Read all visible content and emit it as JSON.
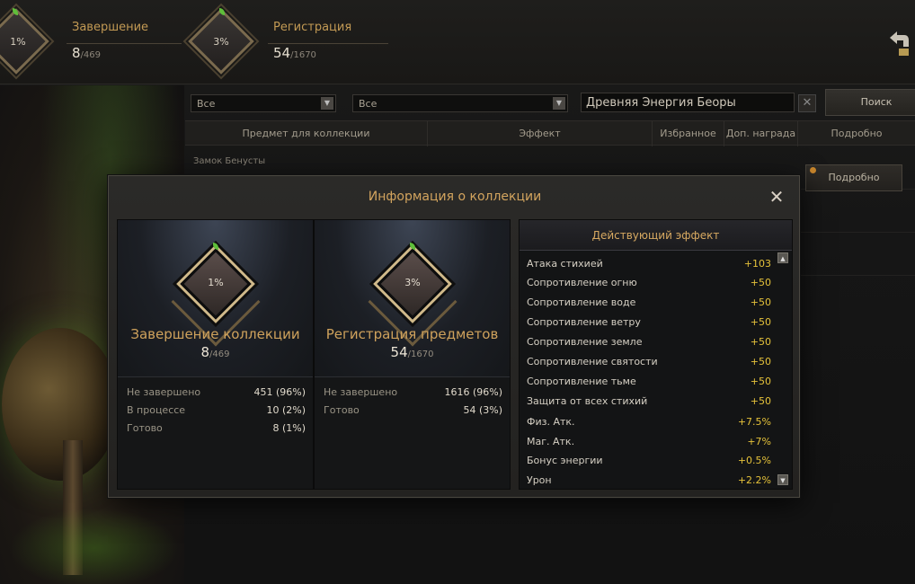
{
  "top": {
    "completion": {
      "percent": "1%",
      "title": "Завершение",
      "count": "8",
      "total": "/469"
    },
    "registration": {
      "percent": "3%",
      "title": "Регистрация",
      "count": "54",
      "total": "/1670"
    }
  },
  "filters": {
    "select1": "Все",
    "select2": "Все",
    "search_value": "Древняя Энергия Беоры",
    "clear_label": "✕",
    "search_button": "Поиск"
  },
  "table": {
    "headers": [
      "Предмет для коллекции",
      "Эффект",
      "Избранное",
      "Доп. награда",
      "Подробно"
    ],
    "row_label": "Замок Бенусты",
    "detail_button": "Подробно"
  },
  "modal": {
    "title": "Информация о коллекции",
    "close": "✕",
    "completion_panel": {
      "percent": "1%",
      "heading": "Завершение коллекции",
      "count": "8",
      "total": "/469",
      "stats": [
        {
          "label": "Не завершено",
          "value": "451 (96%)"
        },
        {
          "label": "В процессе",
          "value": "10 (2%)"
        },
        {
          "label": "Готово",
          "value": "8 (1%)"
        }
      ]
    },
    "registration_panel": {
      "percent": "3%",
      "heading": "Регистрация предметов",
      "count": "54",
      "total": "/1670",
      "stats": [
        {
          "label": "Не завершено",
          "value": "1616 (96%)"
        },
        {
          "label": "Готово",
          "value": "54 (3%)"
        }
      ]
    },
    "effects": {
      "heading": "Действующий эффект",
      "items": [
        {
          "label": "Атака стихией",
          "value": "+103"
        },
        {
          "label": "Сопротивление огню",
          "value": "+50"
        },
        {
          "label": "Сопротивление воде",
          "value": "+50"
        },
        {
          "label": "Сопротивление ветру",
          "value": "+50"
        },
        {
          "label": "Сопротивление земле",
          "value": "+50"
        },
        {
          "label": "Сопротивление святости",
          "value": "+50"
        },
        {
          "label": "Сопротивление тьме",
          "value": "+50"
        },
        {
          "label": "Защита от всех стихий",
          "value": "+50"
        },
        {
          "label": "Физ. Атк.",
          "value": "+7.5%"
        },
        {
          "label": "Маг. Атк.",
          "value": "+7%"
        },
        {
          "label": "Бонус энергии",
          "value": "+0.5%"
        },
        {
          "label": "Урон",
          "value": "+2.2%"
        }
      ]
    }
  },
  "colors": {
    "accent_gold": "#d2a45e",
    "value_yellow": "#e5c23a",
    "leaf_green": "#5fbf3a"
  },
  "icons": {
    "return": "return-arrow-icon",
    "scroll_up": "arrow-up-icon",
    "scroll_down": "arrow-down-icon"
  }
}
